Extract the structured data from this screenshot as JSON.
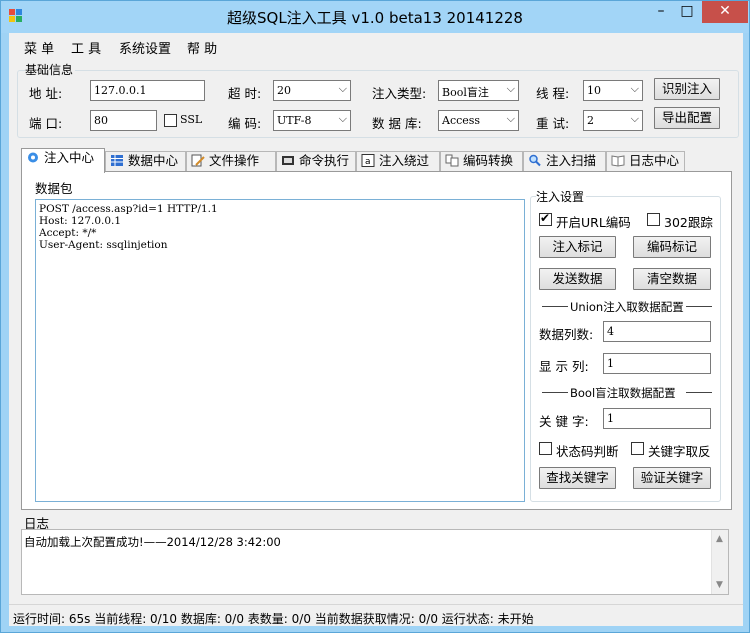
{
  "window": {
    "title": "超级SQL注入工具 v1.0 beta13 20141228",
    "min_glyph": "–",
    "max_glyph": "□",
    "close_glyph": "✕"
  },
  "menu": [
    "菜 单",
    "工 具",
    "系统设置",
    "帮 助"
  ],
  "basic": {
    "group_title": "基础信息",
    "address_label": "地 址:",
    "address_value": "127.0.0.1",
    "port_label": "端 口:",
    "port_value": "80",
    "ssl_label": "SSL",
    "ssl_checked": false,
    "timeout_label": "超 时:",
    "timeout_value": "20",
    "encoding_label": "编 码:",
    "encoding_value": "UTF-8",
    "inject_type_label": "注入类型:",
    "inject_type_value": "Bool盲注",
    "database_label": "数 据 库:",
    "database_value": "Access",
    "threads_label": "线 程:",
    "threads_value": "10",
    "retry_label": "重 试:",
    "retry_value": "2",
    "identify_button": "识别注入",
    "export_button": "导出配置"
  },
  "tabs": [
    {
      "label": "注入中心",
      "icon": "gear-icon",
      "active": true
    },
    {
      "label": "数据中心",
      "icon": "table-icon",
      "active": false
    },
    {
      "label": "文件操作",
      "icon": "file-edit-icon",
      "active": false
    },
    {
      "label": "命令执行",
      "icon": "terminal-icon",
      "active": false
    },
    {
      "label": "注入绕过",
      "icon": "letter-a-icon",
      "active": false
    },
    {
      "label": "编码转换",
      "icon": "convert-icon",
      "active": false
    },
    {
      "label": "注入扫描",
      "icon": "magnifier-icon",
      "active": false
    },
    {
      "label": "日志中心",
      "icon": "book-icon",
      "active": false
    }
  ],
  "inject_center": {
    "packet_title": "数据包",
    "packet_lines": [
      "POST /access.asp?id=1 HTTP/1.1",
      "Host: 127.0.0.1",
      "Accept: */*",
      "User-Agent: ssqlinjetion"
    ],
    "settings_title": "注入设置",
    "url_encode_label": "开启URL编码",
    "url_encode_checked": true,
    "follow_302_label": "302跟踪",
    "follow_302_checked": false,
    "mark_button": "注入标记",
    "encode_mark_button": "编码标记",
    "send_button": "发送数据",
    "clear_button": "清空数据",
    "union_section": "Union注入取数据配置",
    "columns_label": "数据列数:",
    "columns_value": "4",
    "display_col_label": "显 示 列:",
    "display_col_value": "1",
    "bool_section": "Bool盲注取数据配置",
    "keyword_label": "关 键 字:",
    "keyword_value": "1",
    "status_code_label": "状态码判断",
    "status_code_checked": false,
    "invert_label": "关键字取反",
    "invert_checked": false,
    "find_keyword_button": "查找关键字",
    "verify_keyword_button": "验证关键字"
  },
  "log": {
    "title": "日志",
    "entries": [
      "自动加载上次配置成功!——2014/12/28 3:42:00"
    ]
  },
  "status": {
    "text": "运行时间: 65s 当前线程: 0/10 数据库: 0/0 表数量: 0/0 当前数据获取情况: 0/0 运行状态: 未开始"
  }
}
